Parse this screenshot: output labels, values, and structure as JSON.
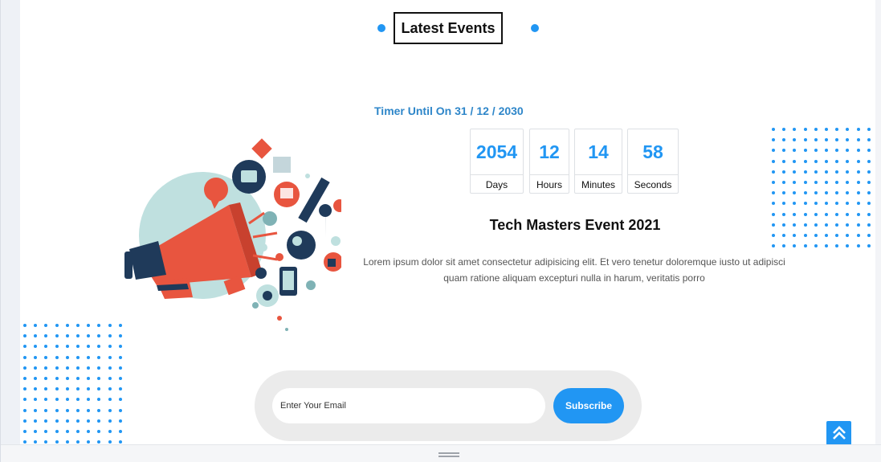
{
  "section": {
    "heading": "Latest Events"
  },
  "timer": {
    "label": "Timer Until On 31 / 12 / 2030",
    "units": [
      {
        "value": "2054",
        "label": "Days"
      },
      {
        "value": "12",
        "label": "Hours"
      },
      {
        "value": "14",
        "label": "Minutes"
      },
      {
        "value": "58",
        "label": "Seconds"
      }
    ]
  },
  "event": {
    "title": "Tech Masters Event 2021",
    "description": "Lorem ipsum dolor sit amet consectetur adipisicing elit. Et vero tenetur doloremque iusto ut adipisci quam ratione aliquam excepturi nulla in harum, veritatis porro"
  },
  "newsletter": {
    "placeholder": "Enter Your Email",
    "button_label": "Subscribe"
  },
  "icons": {
    "illustration": "megaphone-illustration",
    "scroll_top": "double-chevron-up-icon",
    "resize": "drag-handle-icon"
  },
  "colors": {
    "accent": "#2196f3",
    "timer_label": "#2e86c9",
    "megaphone_red": "#e8553f",
    "megaphone_navy": "#1f3a5a",
    "circle_teal": "#b9dede"
  }
}
